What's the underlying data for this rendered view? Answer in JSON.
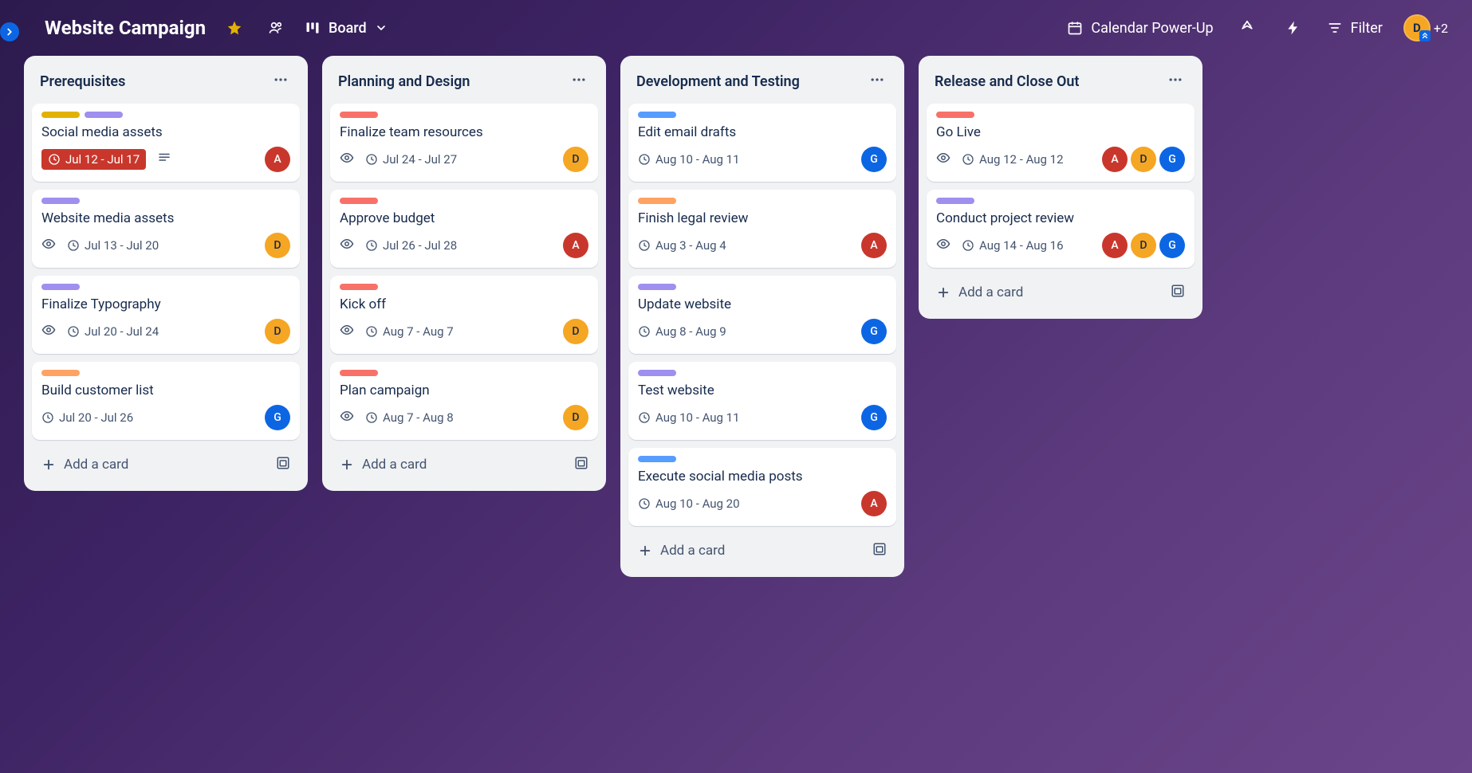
{
  "header": {
    "board_title": "Website Campaign",
    "view_label": "Board",
    "calendar_label": "Calendar Power-Up",
    "filter_label": "Filter",
    "avatar_initial": "D",
    "more_count": "+2"
  },
  "ui": {
    "add_card_label": "Add a card"
  },
  "avatars": {
    "A": "A",
    "D": "D",
    "G": "G"
  },
  "lists": [
    {
      "title": "Prerequisites",
      "cards": [
        {
          "labels": [
            "yellow",
            "purple"
          ],
          "title": "Social media assets",
          "date": "Jul 12 - Jul 17",
          "overdue": true,
          "desc": true,
          "members": [
            "A"
          ]
        },
        {
          "labels": [
            "purple"
          ],
          "title": "Website media assets",
          "date": "Jul 13 - Jul 20",
          "watch": true,
          "members": [
            "D"
          ]
        },
        {
          "labels": [
            "purple"
          ],
          "title": "Finalize Typography",
          "date": "Jul 20 - Jul 24",
          "watch": true,
          "members": [
            "D"
          ]
        },
        {
          "labels": [
            "orange"
          ],
          "title": "Build customer list",
          "date": "Jul 20 - Jul 26",
          "members": [
            "G"
          ]
        }
      ]
    },
    {
      "title": "Planning and Design",
      "cards": [
        {
          "labels": [
            "red"
          ],
          "title": "Finalize team resources",
          "date": "Jul 24 - Jul 27",
          "watch": true,
          "members": [
            "D"
          ]
        },
        {
          "labels": [
            "red"
          ],
          "title": "Approve budget",
          "date": "Jul 26 - Jul 28",
          "watch": true,
          "members": [
            "A"
          ]
        },
        {
          "labels": [
            "red"
          ],
          "title": "Kick off",
          "date": "Aug 7 - Aug 7",
          "watch": true,
          "members": [
            "D"
          ]
        },
        {
          "labels": [
            "red"
          ],
          "title": "Plan campaign",
          "date": "Aug 7 - Aug 8",
          "watch": true,
          "members": [
            "D"
          ]
        }
      ]
    },
    {
      "title": "Development and Testing",
      "cards": [
        {
          "labels": [
            "blue"
          ],
          "title": "Edit email drafts",
          "date": "Aug 10 - Aug 11",
          "members": [
            "G"
          ]
        },
        {
          "labels": [
            "orange"
          ],
          "title": "Finish legal review",
          "date": "Aug 3 - Aug 4",
          "members": [
            "A"
          ]
        },
        {
          "labels": [
            "purple"
          ],
          "title": "Update website",
          "date": "Aug 8 - Aug 9",
          "members": [
            "G"
          ]
        },
        {
          "labels": [
            "purple"
          ],
          "title": "Test website",
          "date": "Aug 10 - Aug 11",
          "members": [
            "G"
          ]
        },
        {
          "labels": [
            "blue"
          ],
          "title": "Execute social media posts",
          "date": "Aug 10 - Aug 20",
          "members": [
            "A"
          ]
        }
      ]
    },
    {
      "title": "Release and Close Out",
      "cards": [
        {
          "labels": [
            "red"
          ],
          "title": "Go Live",
          "date": "Aug 12 - Aug 12",
          "watch": true,
          "members": [
            "A",
            "D",
            "G"
          ]
        },
        {
          "labels": [
            "purple"
          ],
          "title": "Conduct project review",
          "date": "Aug 14 - Aug 16",
          "watch": true,
          "members": [
            "A",
            "D",
            "G"
          ]
        }
      ]
    }
  ]
}
